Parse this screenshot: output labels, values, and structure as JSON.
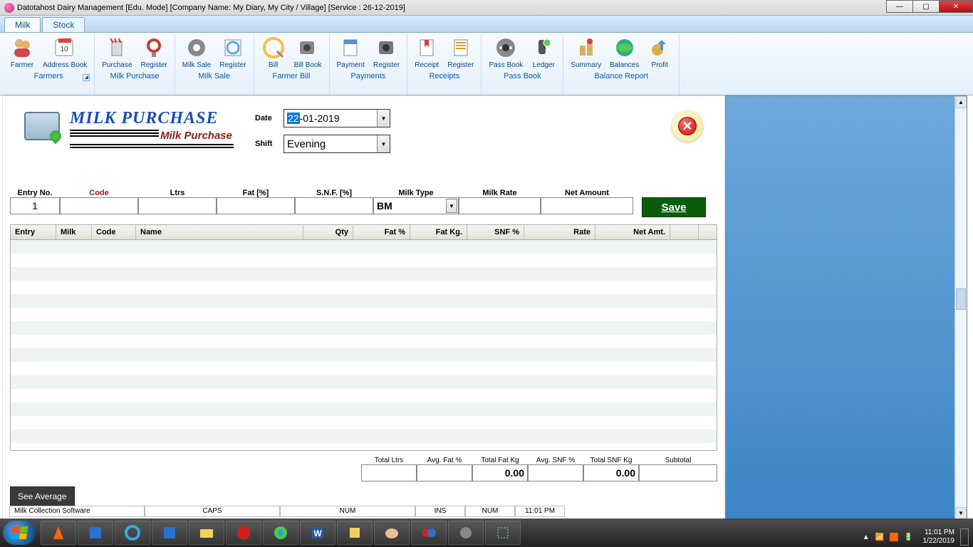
{
  "titlebar": "Datotahost Dairy Management [Edu. Mode] [Company Name: My Diary, My City / Village]   [Service : 26-12-2019]",
  "tabs": {
    "milk": "Milk",
    "stock": "Stock"
  },
  "ribbon": {
    "farmers": {
      "farmer": "Farmer",
      "addressbook": "Address Book",
      "group": "Farmers"
    },
    "milkpurchase": {
      "purchase": "Purchase",
      "register": "Register",
      "group": "Milk Purchase"
    },
    "milksale": {
      "sale": "Milk Sale",
      "register": "Register",
      "group": "Milk Sale"
    },
    "farmerbill": {
      "bill": "Bill",
      "billbook": "Bill Book",
      "group": "Farmer Bill"
    },
    "payments": {
      "payment": "Payment",
      "register": "Register",
      "group": "Payments"
    },
    "receipts": {
      "receipt": "Receipt",
      "register": "Register",
      "group": "Receipts"
    },
    "passbook": {
      "passbook": "Pass Book",
      "ledger": "Ledger",
      "group": "Pass Book"
    },
    "balance": {
      "summary": "Summary",
      "balances": "Balances",
      "profit": "Profit",
      "group": "Balance Report"
    }
  },
  "panel": {
    "title": "MILK PURCHASE",
    "subtitle": "Milk Purchase",
    "date_label": "Date",
    "date_sel": "22",
    "date_rest": "-01-2019",
    "shift_label": "Shift",
    "shift_value": "Evening"
  },
  "entry": {
    "labels": {
      "no": "Entry No.",
      "code": "Code",
      "ltrs": "Ltrs",
      "fat": "Fat [%]",
      "snf": "S.N.F. [%]",
      "milktype": "Milk Type",
      "rate": "Milk Rate",
      "net": "Net Amount"
    },
    "values": {
      "no": "1",
      "milktype": "BM"
    },
    "save": "Save"
  },
  "grid": {
    "headers": {
      "entry": "Entry",
      "milk": "Milk",
      "code": "Code",
      "name": "Name",
      "qty": "Qty",
      "fat": "Fat %",
      "fatkg": "Fat Kg.",
      "snf": "SNF %",
      "rate": "Rate",
      "net": "Net Amt."
    }
  },
  "totals": {
    "labels": {
      "ltrs": "Total Ltrs",
      "avgfat": "Avg. Fat %",
      "fatkg": "Total Fat Kg",
      "avgsnf": "Avg. SNF %",
      "snfkg": "Total SNF Kg",
      "subtotal": "Subtotal"
    },
    "values": {
      "ltrs": "",
      "avgfat": "",
      "fatkg": "0.00",
      "avgsnf": "",
      "snfkg": "0.00",
      "subtotal": ""
    },
    "seeavg": "See Average"
  },
  "statusbar": {
    "app": "Milk Collection Software",
    "caps": "CAPS",
    "num1": "NUM",
    "ins": "INS",
    "num2": "NUM",
    "time": "11:01 PM"
  },
  "tray": {
    "time": "11:01 PM",
    "date": "1/22/2019"
  }
}
